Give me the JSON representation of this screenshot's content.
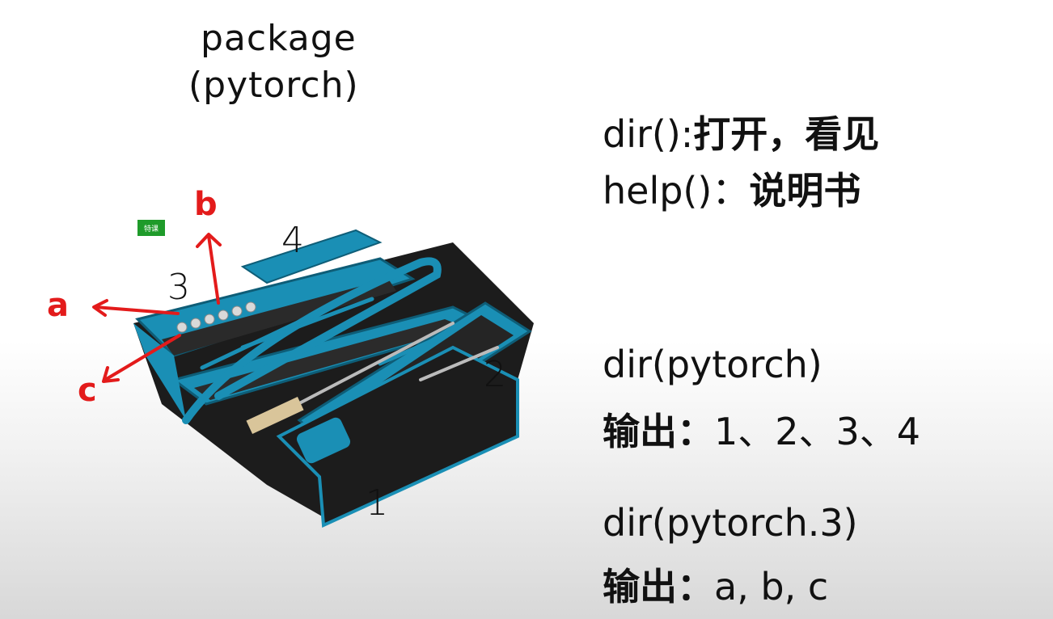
{
  "left": {
    "title_line1": "package",
    "title_line2": "(pytorch)",
    "tag": "特课",
    "labels": {
      "a": "a",
      "b": "b",
      "c": "c",
      "n1": "1",
      "n2": "2",
      "n3": "3",
      "n4": "4"
    }
  },
  "right": {
    "line1_code": "dir():",
    "line1_text": "打开，看见",
    "line2_code": "help()：",
    "line2_text": "说明书",
    "ex1_call": "dir(pytorch)",
    "ex1_label": "输出：",
    "ex1_value": "1、2、3、4",
    "ex2_call": "dir(pytorch.3)",
    "ex2_label": "输出：",
    "ex2_value": "a, b, c"
  },
  "colors": {
    "toolbox_blue": "#1a8fb5",
    "toolbox_dark": "#1c1c1c",
    "annotation_red": "#e31b1b",
    "tag_green": "#1f9b2a"
  }
}
